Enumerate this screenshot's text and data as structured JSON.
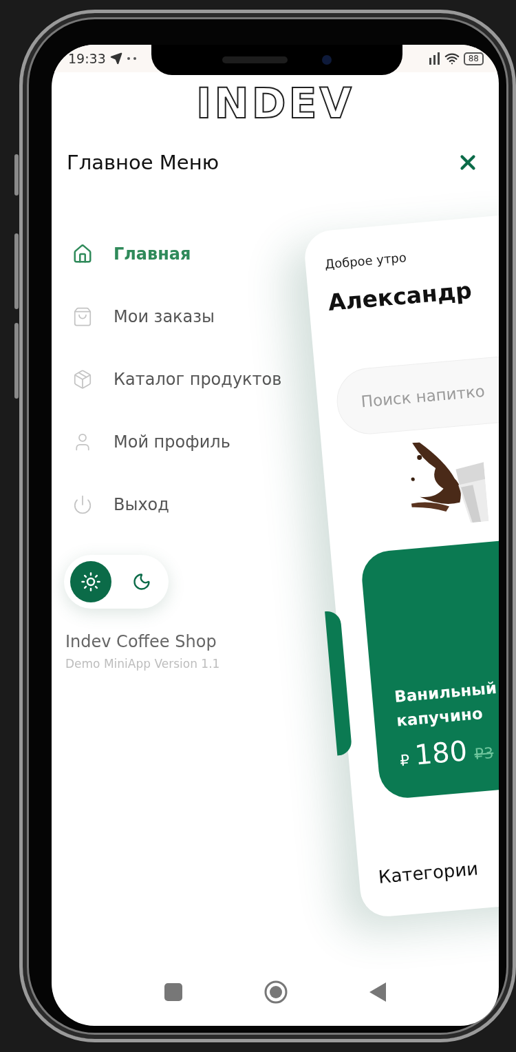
{
  "status_bar": {
    "time": "19:33",
    "battery": "88"
  },
  "logo": "INDEV",
  "header": {
    "title": "Главное Меню"
  },
  "menu": [
    {
      "label": "Главная",
      "kind": "home",
      "selected": true
    },
    {
      "label": "Мои заказы",
      "kind": "bag",
      "selected": false
    },
    {
      "label": "Каталог продуктов",
      "kind": "box",
      "selected": false
    },
    {
      "label": "Мой профиль",
      "kind": "user",
      "selected": false
    },
    {
      "label": "Выход",
      "kind": "power",
      "selected": false
    }
  ],
  "theme_toggle": [
    {
      "kind": "light",
      "selected": true
    },
    {
      "kind": "dark",
      "selected": false
    }
  ],
  "footer": {
    "app_name": "Indev Coffee Shop",
    "version": "Demo MiniApp Version 1.1"
  },
  "home_card": {
    "greeting": "Доброе утро",
    "name": "Александр",
    "search": {
      "placeholder": "Поиск напитко"
    },
    "product": {
      "name": "Ванильный капучино",
      "currency": "₽",
      "price": "180",
      "old_price": "₽3"
    },
    "section_title": "Категории"
  }
}
